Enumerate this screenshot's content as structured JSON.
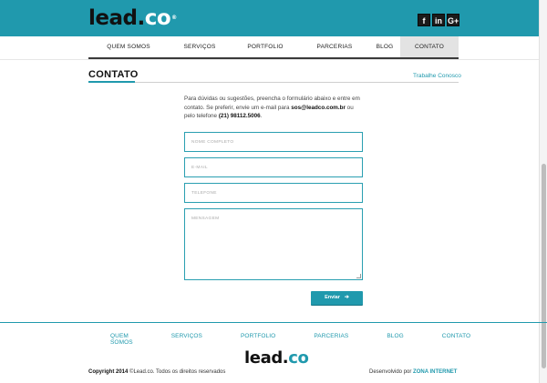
{
  "header": {
    "logo_main": "lead.",
    "logo_co": "co",
    "social": [
      {
        "glyph": "f",
        "icon": "facebook-icon"
      },
      {
        "glyph": "in",
        "icon": "linkedin-icon"
      },
      {
        "glyph": "G+",
        "icon": "google-plus-icon"
      }
    ]
  },
  "nav": {
    "items": [
      {
        "label": "QUEM SOMOS",
        "active": false
      },
      {
        "label": "SERVIÇOS",
        "active": false
      },
      {
        "label": "PORTFOLIO",
        "active": false
      },
      {
        "label": "PARCERIAS",
        "active": false
      },
      {
        "label": "BLOG",
        "active": false
      },
      {
        "label": "CONTATO",
        "active": true
      }
    ]
  },
  "page": {
    "title": "CONTATO",
    "side_link": "Trabalhe Conosco",
    "intro_text_1": "Para dúvidas ou sugestões, preencha o formulário abaixo e entre em contato. Se preferir, envie um e-mail para ",
    "intro_email": "sos@leadco.com.br",
    "intro_text_2": " ou pelo telefone ",
    "intro_phone": "(21) 98112.5006",
    "intro_text_3": "."
  },
  "form": {
    "name_placeholder": "NOME COMPLETO",
    "email_placeholder": "E-MAIL",
    "phone_placeholder": "TELEFONE",
    "message_placeholder": "MENSAGEM",
    "submit_label": "Enviar",
    "submit_arrow": "➔"
  },
  "footer": {
    "nav": [
      "QUEM SOMOS",
      "SERVIÇOS",
      "PORTFOLIO",
      "PARCERIAS",
      "BLOG",
      "CONTATO"
    ],
    "logo_main": "lead.",
    "logo_co": "co",
    "copyright_bold": "Copyright 2014",
    "copyright_rest": " ©Lead.co. Todos os direitos reservados",
    "dev_prefix": "Desenvolvido por ",
    "dev_brand": "ZONA INTERNET"
  },
  "colors": {
    "accent": "#2099ad",
    "dark": "#1b1b1b",
    "active_tab": "#e3e3e3"
  }
}
